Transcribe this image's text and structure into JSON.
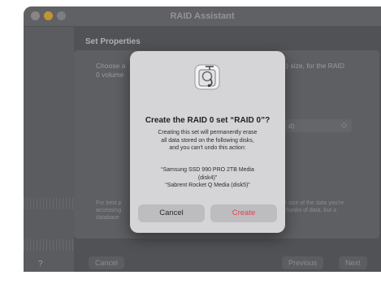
{
  "window": {
    "title": "RAID Assistant"
  },
  "section": {
    "title": "Set Properties"
  },
  "description": {
    "left_line1": "Choose a",
    "left_line2": "0 volume",
    "right_line1": "k) size, for the RAID"
  },
  "chunk_select": {
    "value": "d)",
    "chevron": "◇"
  },
  "hint": {
    "left_line1": "For best p",
    "left_line2": "accessing",
    "left_line3": "database",
    "right_line1": "e size of the data you're",
    "right_line2": "chunks of data, but a"
  },
  "bottom_bar": {
    "help": "?",
    "cancel": "Cancel",
    "previous": "Previous",
    "next": "Next"
  },
  "dialog": {
    "title": "Create the RAID 0 set “RAID 0”?",
    "message_line1": "Creating this set will permanently erase",
    "message_line2": "all data stored on the following disks,",
    "message_line3": "and you can't undo this action:",
    "disk1_line1": "“Samsung SSD 990 PRO 2TB Media",
    "disk1_line2": "(disk4)”",
    "disk2": "“Sabrent Rocket Q Media (disk5)”",
    "cancel_label": "Cancel",
    "create_label": "Create",
    "icon": "disk-utility-icon"
  },
  "colors": {
    "destructive": "#e0434e",
    "sheet": "#d5d5d8"
  }
}
